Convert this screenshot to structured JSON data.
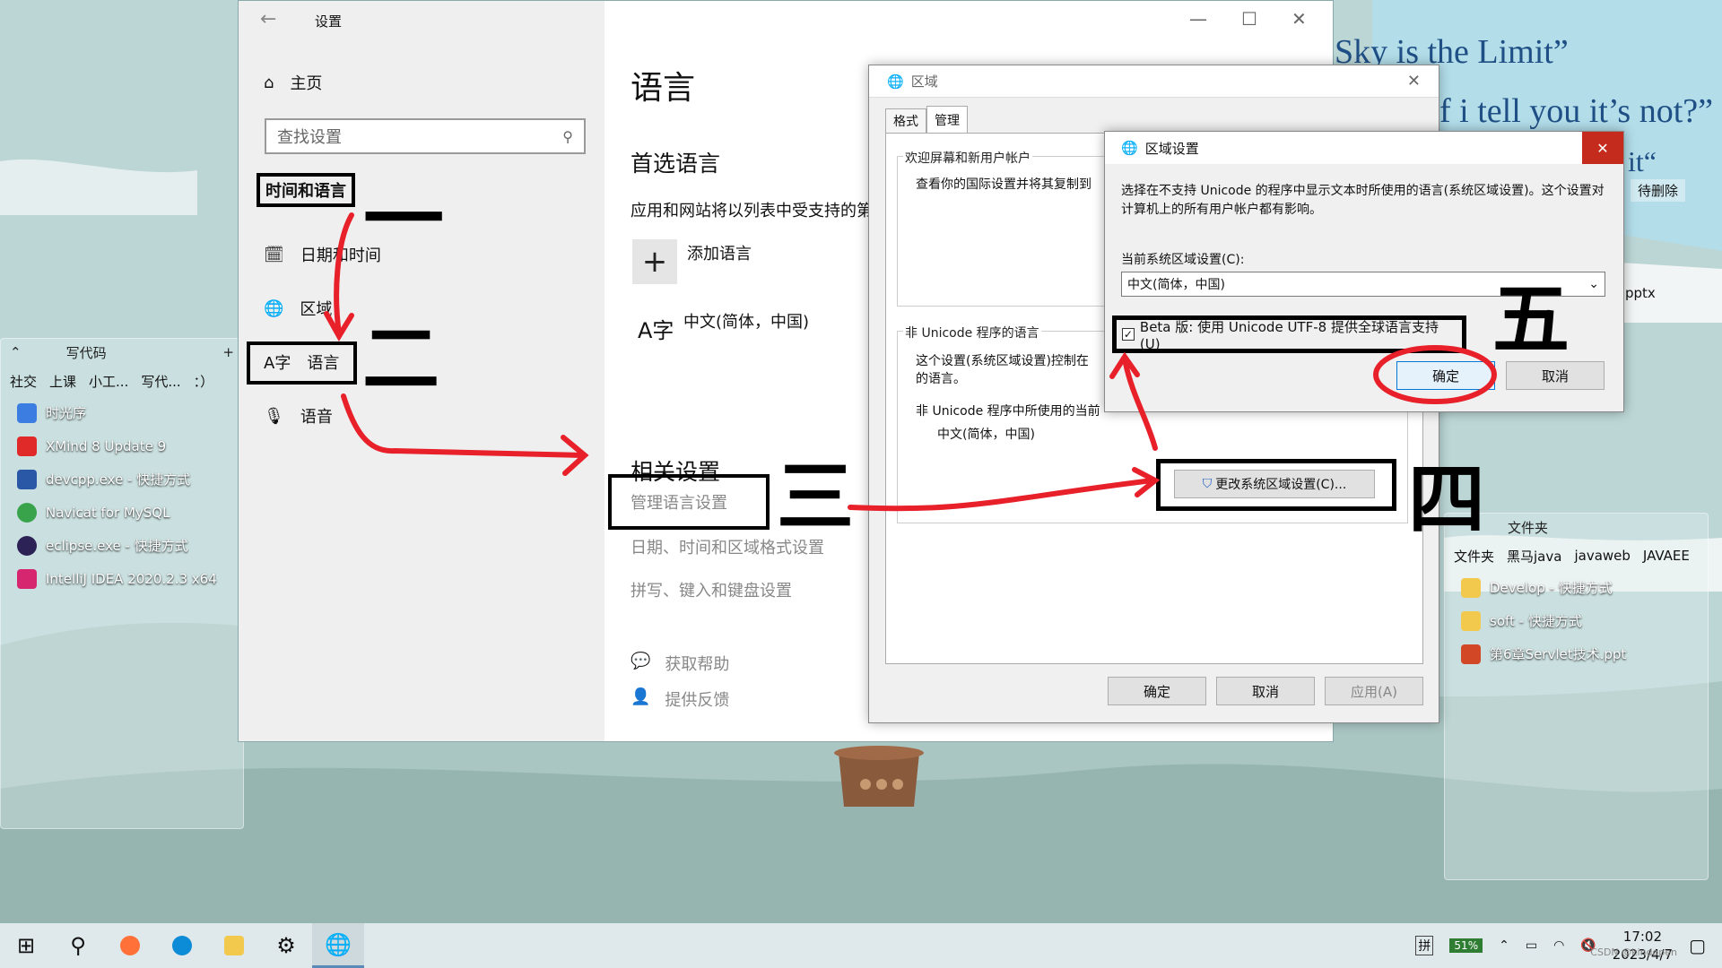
{
  "desktop": {
    "quotes": [
      "Sky is the Limit”",
      "f i tell you it’s not?”",
      "it“"
    ],
    "fence_left": {
      "title": "写代码",
      "tabs": [
        "社交",
        "上课",
        "小工...",
        "写代...",
        "：）"
      ],
      "items": [
        "时光序",
        "XMind 8 Update 9",
        "devcpp.exe - 快捷方式",
        "Navicat for MySQL",
        "eclipse.exe - 快捷方式",
        "IntelliJ IDEA 2020.2.3 x64"
      ]
    },
    "fence_right": {
      "title": "文件夹",
      "tabs": [
        "文件夹",
        "黑马java",
        "javaweb",
        "JAVAEE"
      ],
      "items": [
        "Develop - 快捷方式",
        "soft - 快捷方式",
        "第6章Servlet技术.ppt"
      ],
      "top_badge": "待删除",
      "pptx_label": "pptx"
    }
  },
  "settings": {
    "window_title": "设置",
    "home": "主页",
    "search_placeholder": "查找设置",
    "section": "时间和语言",
    "nav": [
      "日期和时间",
      "区域",
      "语言",
      "语音"
    ],
    "page_title": "语言",
    "preferred_heading": "首选语言",
    "preferred_desc": "应用和网站将以列表中受支持的第",
    "add_language": "添加语言",
    "language_item": "中文(简体，中国)",
    "related_heading": "相关设置",
    "related_links": [
      "管理语言设置",
      "日期、时间和区域格式设置",
      "拼写、键入和键盘设置"
    ],
    "help": "获取帮助",
    "feedback": "提供反馈"
  },
  "region_dialog": {
    "title": "区域",
    "tabs": [
      "格式",
      "管理"
    ],
    "welcome_group": "欢迎屏幕和新用户帐户",
    "welcome_desc": "查看你的国际设置并将其复制到",
    "unicode_group": "非 Unicode 程序的语言",
    "unicode_desc": "这个设置(系统区域设置)控制在",
    "unicode_desc2": "的语言。",
    "current_label": "非 Unicode 程序中所使用的当前",
    "current_value": "中文(简体，中国)",
    "change_button": "更改系统区域设置(C)...",
    "ok": "确定",
    "cancel": "取消",
    "apply": "应用(A)"
  },
  "region_settings_dialog": {
    "title": "区域设置",
    "description": "选择在不支持 Unicode 的程序中显示文本时所使用的语言(系统区域设置)。这个设置对计算机上的所有用户帐户都有影响。",
    "current_label": "当前系统区域设置(C):",
    "current_value": "中文(简体，中国)",
    "beta_checkbox": "Beta 版: 使用 Unicode UTF-8 提供全球语言支持(U)",
    "ok": "确定",
    "cancel": "取消"
  },
  "annotations": [
    "一",
    "二",
    "三",
    "四",
    "五"
  ],
  "taskbar": {
    "ime": "拼",
    "battery": "51%",
    "time": "17:02",
    "date": "2023/4/7",
    "watermark": "CSDN @kindopen"
  },
  "colors": {
    "annotation_red": "#e8202a",
    "accent": "#0078d7"
  }
}
